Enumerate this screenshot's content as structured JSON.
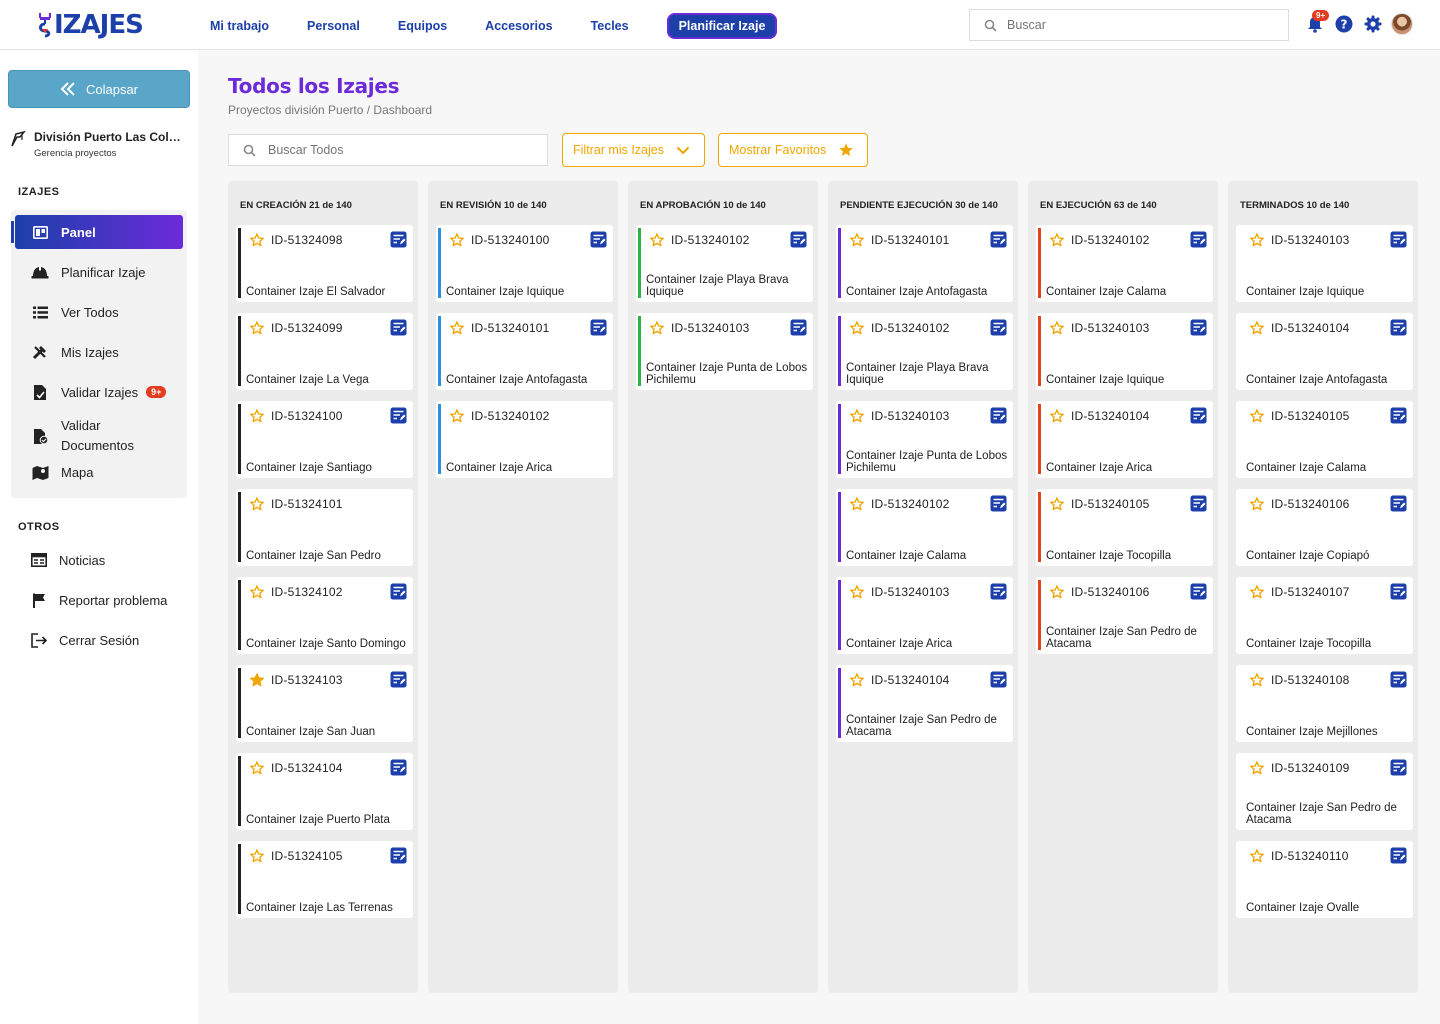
{
  "brand": {
    "logo_text": "IZAJES"
  },
  "topnav": {
    "items": [
      "Mi trabajo",
      "Personal",
      "Equipos",
      "Accesorios",
      "Tecles"
    ],
    "plan_button": "Planificar Izaje"
  },
  "search_top": {
    "placeholder": "Buscar"
  },
  "notifications": {
    "badge": "9+"
  },
  "sidebar": {
    "collapse_label": "Colapsar",
    "division_name": "División Puerto Las Colm...",
    "division_sub": "Gerencia proyectos",
    "section_izajes": "IZAJES",
    "items": [
      {
        "label": "Panel",
        "icon": "board-icon"
      },
      {
        "label": "Planificar Izaje",
        "icon": "hardhat-icon"
      },
      {
        "label": "Ver Todos",
        "icon": "list-icon"
      },
      {
        "label": "Mis Izajes",
        "icon": "tools-icon"
      },
      {
        "label": "Validar Izajes",
        "icon": "file-check-icon",
        "badge": "9+"
      },
      {
        "label": "Validar Documentos",
        "icon": "doc-check-icon"
      },
      {
        "label": "Mapa",
        "icon": "map-icon"
      }
    ],
    "section_otros": "OTROS",
    "otros": [
      {
        "label": "Noticias",
        "icon": "news-icon"
      },
      {
        "label": "Reportar problema",
        "icon": "flag-icon"
      },
      {
        "label": "Cerrar Sesión",
        "icon": "logout-icon"
      }
    ]
  },
  "main": {
    "title": "Todos los Izajes",
    "breadcrumb": "Proyectos división Puerto / Dashboard",
    "search_placeholder": "Buscar Todos",
    "filter_label": "Filtrar mis Izajes",
    "favorites_label": "Mostrar Favoritos"
  },
  "colors": {
    "accent": "#1c3faa",
    "purple": "#6c2bd9",
    "orange": "#f0a500",
    "badge": "#e53b1f"
  },
  "columns": [
    {
      "title": "EN CREACIÓN 21 de 140",
      "color": "#222222",
      "cards": [
        {
          "id": "ID-51324098",
          "name": "Container Izaje El Salvador",
          "fav": false
        },
        {
          "id": "ID-51324099",
          "name": "Container Izaje La Vega",
          "fav": false
        },
        {
          "id": "ID-51324100",
          "name": "Container Izaje Santiago",
          "fav": false
        },
        {
          "id": "ID-51324101",
          "name": "Container Izaje San Pedro",
          "fav": false,
          "no_note": true
        },
        {
          "id": "ID-51324102",
          "name": "Container Izaje Santo Domingo",
          "fav": false
        },
        {
          "id": "ID-51324103",
          "name": "Container Izaje San Juan",
          "fav": true
        },
        {
          "id": "ID-51324104",
          "name": "Container Izaje Puerto Plata",
          "fav": false
        },
        {
          "id": "ID-51324105",
          "name": "Container Izaje Las Terrenas",
          "fav": false
        }
      ]
    },
    {
      "title": "EN REVISIÓN 10 de 140",
      "color": "#2f8fe0",
      "cards": [
        {
          "id": "ID-513240100",
          "name": "Container Izaje Iquique",
          "fav": false
        },
        {
          "id": "ID-513240101",
          "name": "Container Izaje Antofagasta",
          "fav": false
        },
        {
          "id": "ID-513240102",
          "name": "Container Izaje Arica",
          "fav": false,
          "no_note": true
        }
      ]
    },
    {
      "title": "EN APROBACIÓN 10 de 140",
      "color": "#2bb34a",
      "cards": [
        {
          "id": "ID-513240102",
          "name": "Container Izaje Playa Brava Iquique",
          "fav": false
        },
        {
          "id": "ID-513240103",
          "name": "Container Izaje Punta de Lobos Pichilemu",
          "fav": false
        }
      ]
    },
    {
      "title": "PENDIENTE EJECUCIÓN 30 de 140",
      "color": "#6c2bd9",
      "cards": [
        {
          "id": "ID-513240101",
          "name": "Container Izaje Antofagasta",
          "fav": false
        },
        {
          "id": "ID-513240102",
          "name": "Container Izaje Playa Brava Iquique",
          "fav": false
        },
        {
          "id": "ID-513240103",
          "name": "Container Izaje Punta de Lobos Pichilemu",
          "fav": false
        },
        {
          "id": "ID-513240102",
          "name": "Container Izaje Calama",
          "fav": false
        },
        {
          "id": "ID-513240103",
          "name": "Container Izaje Arica",
          "fav": false
        },
        {
          "id": "ID-513240104",
          "name": "Container Izaje San Pedro de Atacama",
          "fav": false
        }
      ]
    },
    {
      "title": "EN EJECUCIÓN 63 de 140",
      "color": "#e0451f",
      "cards": [
        {
          "id": "ID-513240102",
          "name": "Container Izaje Calama",
          "fav": false
        },
        {
          "id": "ID-513240103",
          "name": "Container Izaje Iquique",
          "fav": false
        },
        {
          "id": "ID-513240104",
          "name": "Container Izaje Arica",
          "fav": false
        },
        {
          "id": "ID-513240105",
          "name": "Container Izaje Tocopilla",
          "fav": false
        },
        {
          "id": "ID-513240106",
          "name": "Container Izaje San Pedro de Atacama",
          "fav": false
        }
      ]
    },
    {
      "title": "TERMINADOS 10 de 140",
      "color": "#ffffff",
      "cards": [
        {
          "id": "ID-513240103",
          "name": "Container Izaje Iquique",
          "fav": false
        },
        {
          "id": "ID-513240104",
          "name": "Container Izaje Antofagasta",
          "fav": false
        },
        {
          "id": "ID-513240105",
          "name": "Container Izaje Calama",
          "fav": false
        },
        {
          "id": "ID-513240106",
          "name": "Container Izaje Copiapó",
          "fav": false
        },
        {
          "id": "ID-513240107",
          "name": "Container Izaje Tocopilla",
          "fav": false
        },
        {
          "id": "ID-513240108",
          "name": "Container Izaje Mejillones",
          "fav": false
        },
        {
          "id": "ID-513240109",
          "name": "Container Izaje San Pedro de Atacama",
          "fav": false
        },
        {
          "id": "ID-513240110",
          "name": "Container Izaje Ovalle",
          "fav": false
        }
      ]
    }
  ]
}
